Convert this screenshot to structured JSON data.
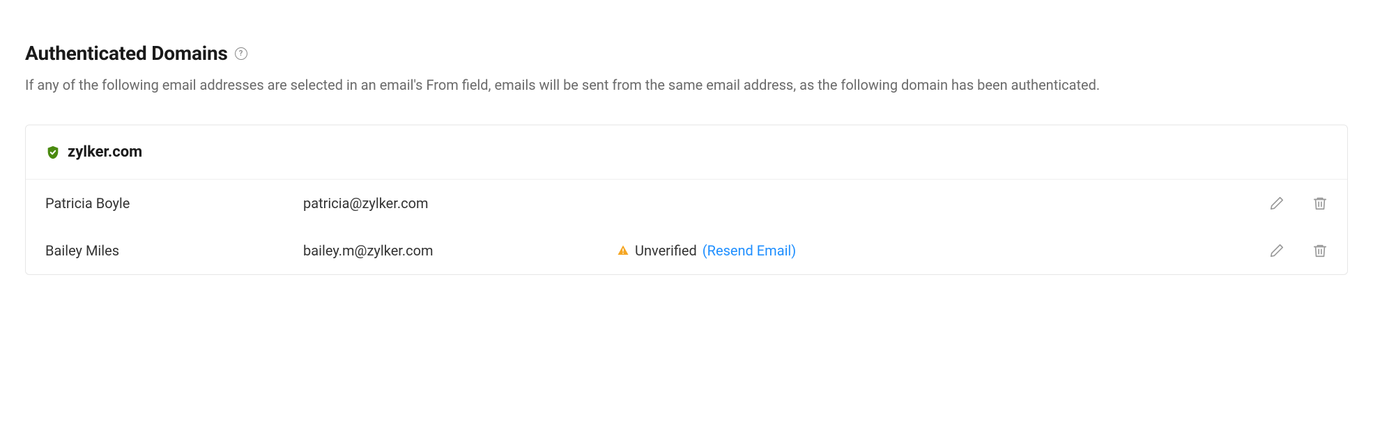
{
  "header": {
    "title": "Authenticated Domains",
    "help_glyph": "?",
    "description": "If any of the following email addresses are selected in an email's From field, emails will be sent from the same email address, as the following domain has been authenticated."
  },
  "domain": {
    "name": "zylker.com",
    "shield_color": "#4a8a0f"
  },
  "rows": [
    {
      "name": "Patricia Boyle",
      "email": "patricia@zylker.com",
      "unverified": false
    },
    {
      "name": "Bailey Miles",
      "email": "bailey.m@zylker.com",
      "unverified": true
    }
  ],
  "labels": {
    "unverified": "Unverified",
    "resend": "(Resend Email)"
  }
}
